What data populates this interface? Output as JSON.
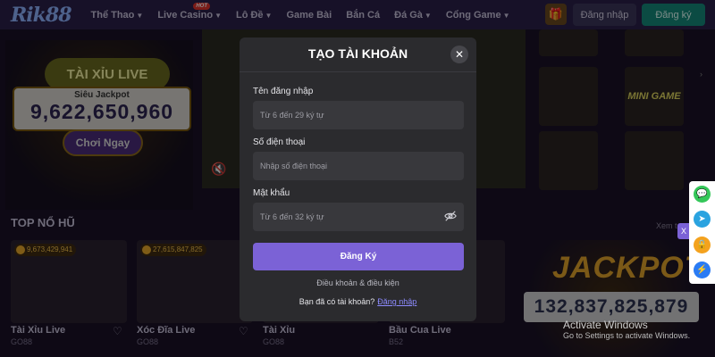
{
  "header": {
    "logo": "Rik88",
    "nav": [
      {
        "label": "Thể Thao",
        "dropdown": true
      },
      {
        "label": "Live Casino",
        "dropdown": true,
        "badge": "HOT"
      },
      {
        "label": "Lô Đề",
        "dropdown": true
      },
      {
        "label": "Game Bài",
        "dropdown": false
      },
      {
        "label": "Bắn Cá",
        "dropdown": false
      },
      {
        "label": "Đá Gà",
        "dropdown": true
      },
      {
        "label": "Cổng Game",
        "dropdown": true
      }
    ],
    "login": "Đăng nhập",
    "register": "Đăng ký"
  },
  "background": {
    "jackpot_card": {
      "badge": "TÀI XỈU LIVE",
      "label": "Siêu Jackpot",
      "value": "9,622,650,960",
      "play": "Chơi Ngay"
    },
    "mini_game": "MINI GAME",
    "top_title": "TOP NỔ HŨ",
    "xem_them": "Xem t",
    "games": [
      {
        "name": "Tài Xỉu Live",
        "sub": "GO88",
        "jackpot": "9,673,429,941"
      },
      {
        "name": "Xóc Đĩa Live",
        "sub": "GO88",
        "jackpot": "27,615,847,825"
      },
      {
        "name": "Tài Xỉu",
        "sub": "GO88",
        "jackpot": ""
      },
      {
        "name": "Bầu Cua Live",
        "sub": "B52",
        "jackpot": ""
      }
    ],
    "jackpot_banner": {
      "word": "JACKPOT",
      "amount": "132,837,825,879"
    }
  },
  "modal": {
    "title": "TẠO TÀI KHOẢN",
    "username": {
      "label": "Tên đăng nhập",
      "placeholder": "Từ 6 đến 29 ký tự"
    },
    "phone": {
      "label": "Số điện thoại",
      "placeholder": "Nhập số điện thoại"
    },
    "password": {
      "label": "Mật khẩu",
      "placeholder": "Từ 6 đến 32 ký tự"
    },
    "submit": "Đăng Ký",
    "terms": "Điều khoản & điều kiện",
    "have_account": "Bạn đã có tài khoản?",
    "login_link": "Đăng nhập"
  },
  "windows_notice": {
    "title": "Activate Windows",
    "sub": "Go to Settings to activate Windows."
  },
  "colors": {
    "accent": "#7b62d6",
    "register": "#14897a",
    "modal_bg": "#2b2b2e"
  }
}
